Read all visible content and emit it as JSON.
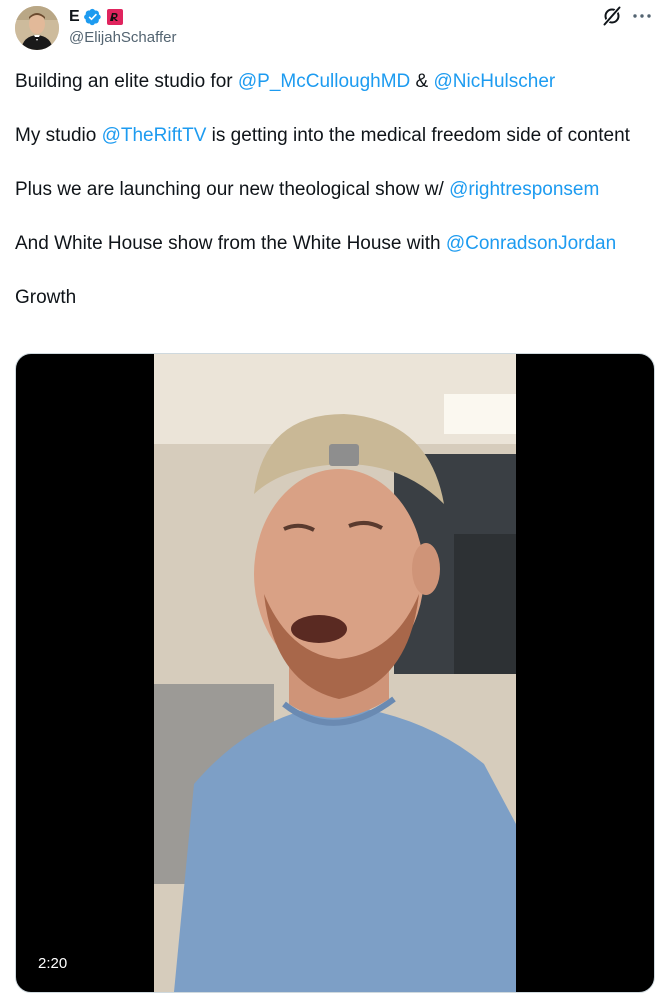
{
  "author": {
    "display_name": "E",
    "handle": "@ElijahSchaffer",
    "verified_badge_color": "#1d9bf0",
    "affiliate_badge_color": "#e0245e"
  },
  "header_icons": {
    "grok": "grok-icon",
    "more": "more-options-icon"
  },
  "text": {
    "line1_prefix": "Building an elite studio for ",
    "line1_mention1": "@P_McCulloughMD",
    "line1_amp": " & ",
    "line1_mention2": "@NicHulscher",
    "line2_prefix": "My studio ",
    "line2_mention": "@TheRiftTV",
    "line2_suffix": " is getting into the medical freedom side of content",
    "line3_prefix": "Plus we are launching our new theological show w/ ",
    "line3_mention": "@rightresponsem",
    "line4_prefix": "And White House show from the White House with ",
    "line4_mention": "@ConradsonJordan",
    "line5": "Growth"
  },
  "video": {
    "duration": "2:20"
  },
  "colors": {
    "mention": "#1d9bf0",
    "text": "#0f1419",
    "secondary": "#536471"
  }
}
